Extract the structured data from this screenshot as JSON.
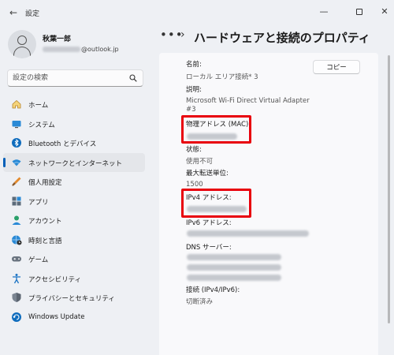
{
  "window": {
    "title": "設定",
    "minimize_glyph": "—",
    "close_glyph": "✕",
    "back_glyph": "←"
  },
  "user": {
    "name": "秋葉一郎",
    "email_domain": "@outlook.jp"
  },
  "search": {
    "placeholder": "設定の検索"
  },
  "nav": {
    "items": [
      {
        "label": "ホーム",
        "icon": "home-icon"
      },
      {
        "label": "システム",
        "icon": "monitor-icon"
      },
      {
        "label": "Bluetooth とデバイス",
        "icon": "bluetooth-icon"
      },
      {
        "label": "ネットワークとインターネット",
        "icon": "wifi-icon",
        "selected": true
      },
      {
        "label": "個人用設定",
        "icon": "brush-icon"
      },
      {
        "label": "アプリ",
        "icon": "apps-icon"
      },
      {
        "label": "アカウント",
        "icon": "person-icon"
      },
      {
        "label": "時刻と言語",
        "icon": "globe-clock-icon"
      },
      {
        "label": "ゲーム",
        "icon": "gamepad-icon"
      },
      {
        "label": "アクセシビリティ",
        "icon": "accessibility-icon"
      },
      {
        "label": "プライバシーとセキュリティ",
        "icon": "shield-icon"
      },
      {
        "label": "Windows Update",
        "icon": "update-icon"
      }
    ]
  },
  "breadcrumb": {
    "dots": "•••",
    "separator": "›",
    "title": "ハードウェアと接続のプロパティ"
  },
  "properties": {
    "name_label": "名前:",
    "name_value": "ローカル エリア接続* 3",
    "desc_label": "説明:",
    "desc_value_line1": "Microsoft Wi-Fi Direct Virtual Adapter",
    "desc_value_line2": "#3",
    "mac_label": "物理アドレス (MAC):",
    "status_label": "状態:",
    "status_value": "使用不可",
    "mtu_label": "最大転送単位:",
    "mtu_value": "1500",
    "ipv4_label": "IPv4 アドレス:",
    "ipv6_label": "IPv6 アドレス:",
    "dns_label": "DNS サーバー:",
    "conn_label": "接続 (IPv4/IPv6):",
    "conn_value": "切断済み"
  },
  "copy_button": {
    "label": "コピー"
  },
  "colors": {
    "accent": "#005fb8",
    "highlight": "#e8000c",
    "background": "#eef0f4",
    "card": "#f9f9fb"
  }
}
